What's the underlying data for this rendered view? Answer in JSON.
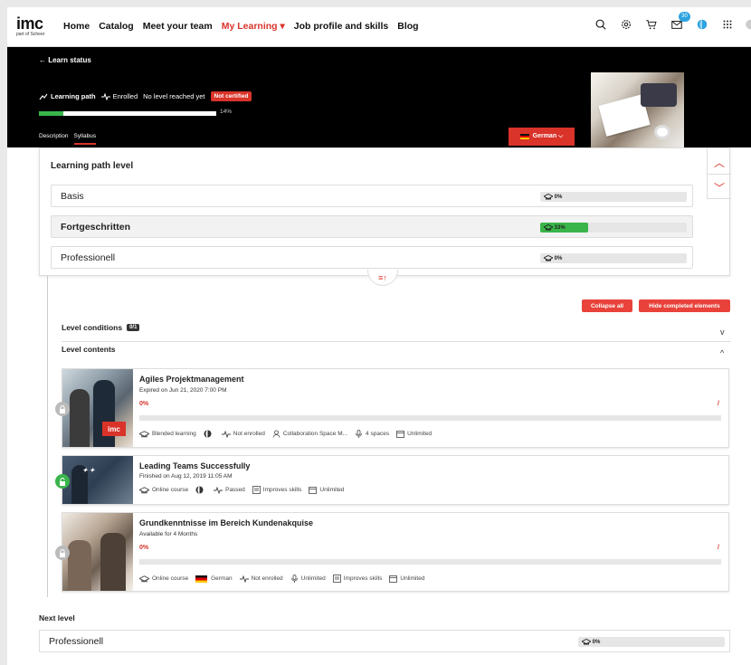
{
  "nav": {
    "logo_main": "imc",
    "logo_sub": "part of Scheer",
    "items": [
      {
        "label": "Home",
        "active": false
      },
      {
        "label": "Catalog",
        "active": false
      },
      {
        "label": "Meet your team",
        "active": false
      },
      {
        "label": "My Learning",
        "active": true
      },
      {
        "label": "Job profile and skills",
        "active": false
      },
      {
        "label": "Blog",
        "active": false
      }
    ],
    "my_learning_caret": "▾",
    "message_badge": "30",
    "icons": [
      "search-icon",
      "settings-icon",
      "cart-icon",
      "messages-icon",
      "globe-icon",
      "apps-grid-icon"
    ]
  },
  "hero": {
    "back_label": "← Learn status",
    "type_label": "Learning path",
    "enrolled_label": "Enrolled",
    "level_status": "No level reached yet",
    "cert_badge": "Not certified",
    "progress_percent": 14,
    "progress_label": "14%",
    "tabs": [
      {
        "label": "Description",
        "active": false
      },
      {
        "label": "Syllabus",
        "active": true
      }
    ],
    "language_button": "German ⌵"
  },
  "level_card": {
    "title": "Learning path level",
    "levels": [
      {
        "name": "Basis",
        "progress": 0,
        "label": "0%",
        "selected": false
      },
      {
        "name": "Fortgeschritten",
        "progress": 33,
        "label": "33%",
        "selected": true
      },
      {
        "name": "Professionell",
        "progress": 0,
        "label": "0%",
        "selected": false
      }
    ],
    "up_arrow": "︿",
    "down_arrow": "﹀",
    "collapse_glyph": "≡↑"
  },
  "actions": {
    "collapse_all": "Collapse all",
    "hide_completed": "Hide completed elements"
  },
  "sections": {
    "conditions_title": "Level conditions",
    "conditions_count": "0/1",
    "conditions_chevron": "v",
    "contents_title": "Level contents",
    "contents_chevron": "^"
  },
  "courses": [
    {
      "title": "Agiles Projektmanagement",
      "subtitle": "Expired on Jun 21, 2020 7:00 PM",
      "percent": "0%",
      "slash": "/",
      "image_badge": "imc",
      "meta": [
        "Blended learning",
        "",
        "Not enrolled",
        "Collaboration Space M...",
        "4 spaces",
        "Unlimited"
      ]
    },
    {
      "title": "Leading Teams Successfully",
      "subtitle": "Finished on Aug 12, 2019 11:05 AM",
      "meta": [
        "Online course",
        "",
        "Passed",
        "Improves skills",
        "Unlimited"
      ]
    },
    {
      "title": "Grundkenntnisse im Bereich Kundenakquise",
      "subtitle": "Available for 4 Months",
      "percent": "0%",
      "slash": "/",
      "meta": [
        "Online course",
        "German",
        "Not enrolled",
        "Unlimited",
        "Improves skills",
        "Unlimited"
      ]
    }
  ],
  "next_level": {
    "title": "Next level",
    "name": "Professionell",
    "progress": 0,
    "label": "0%"
  },
  "colors": {
    "accent": "#d9332a",
    "success": "#39b54a",
    "badge": "#2ea3e0"
  }
}
